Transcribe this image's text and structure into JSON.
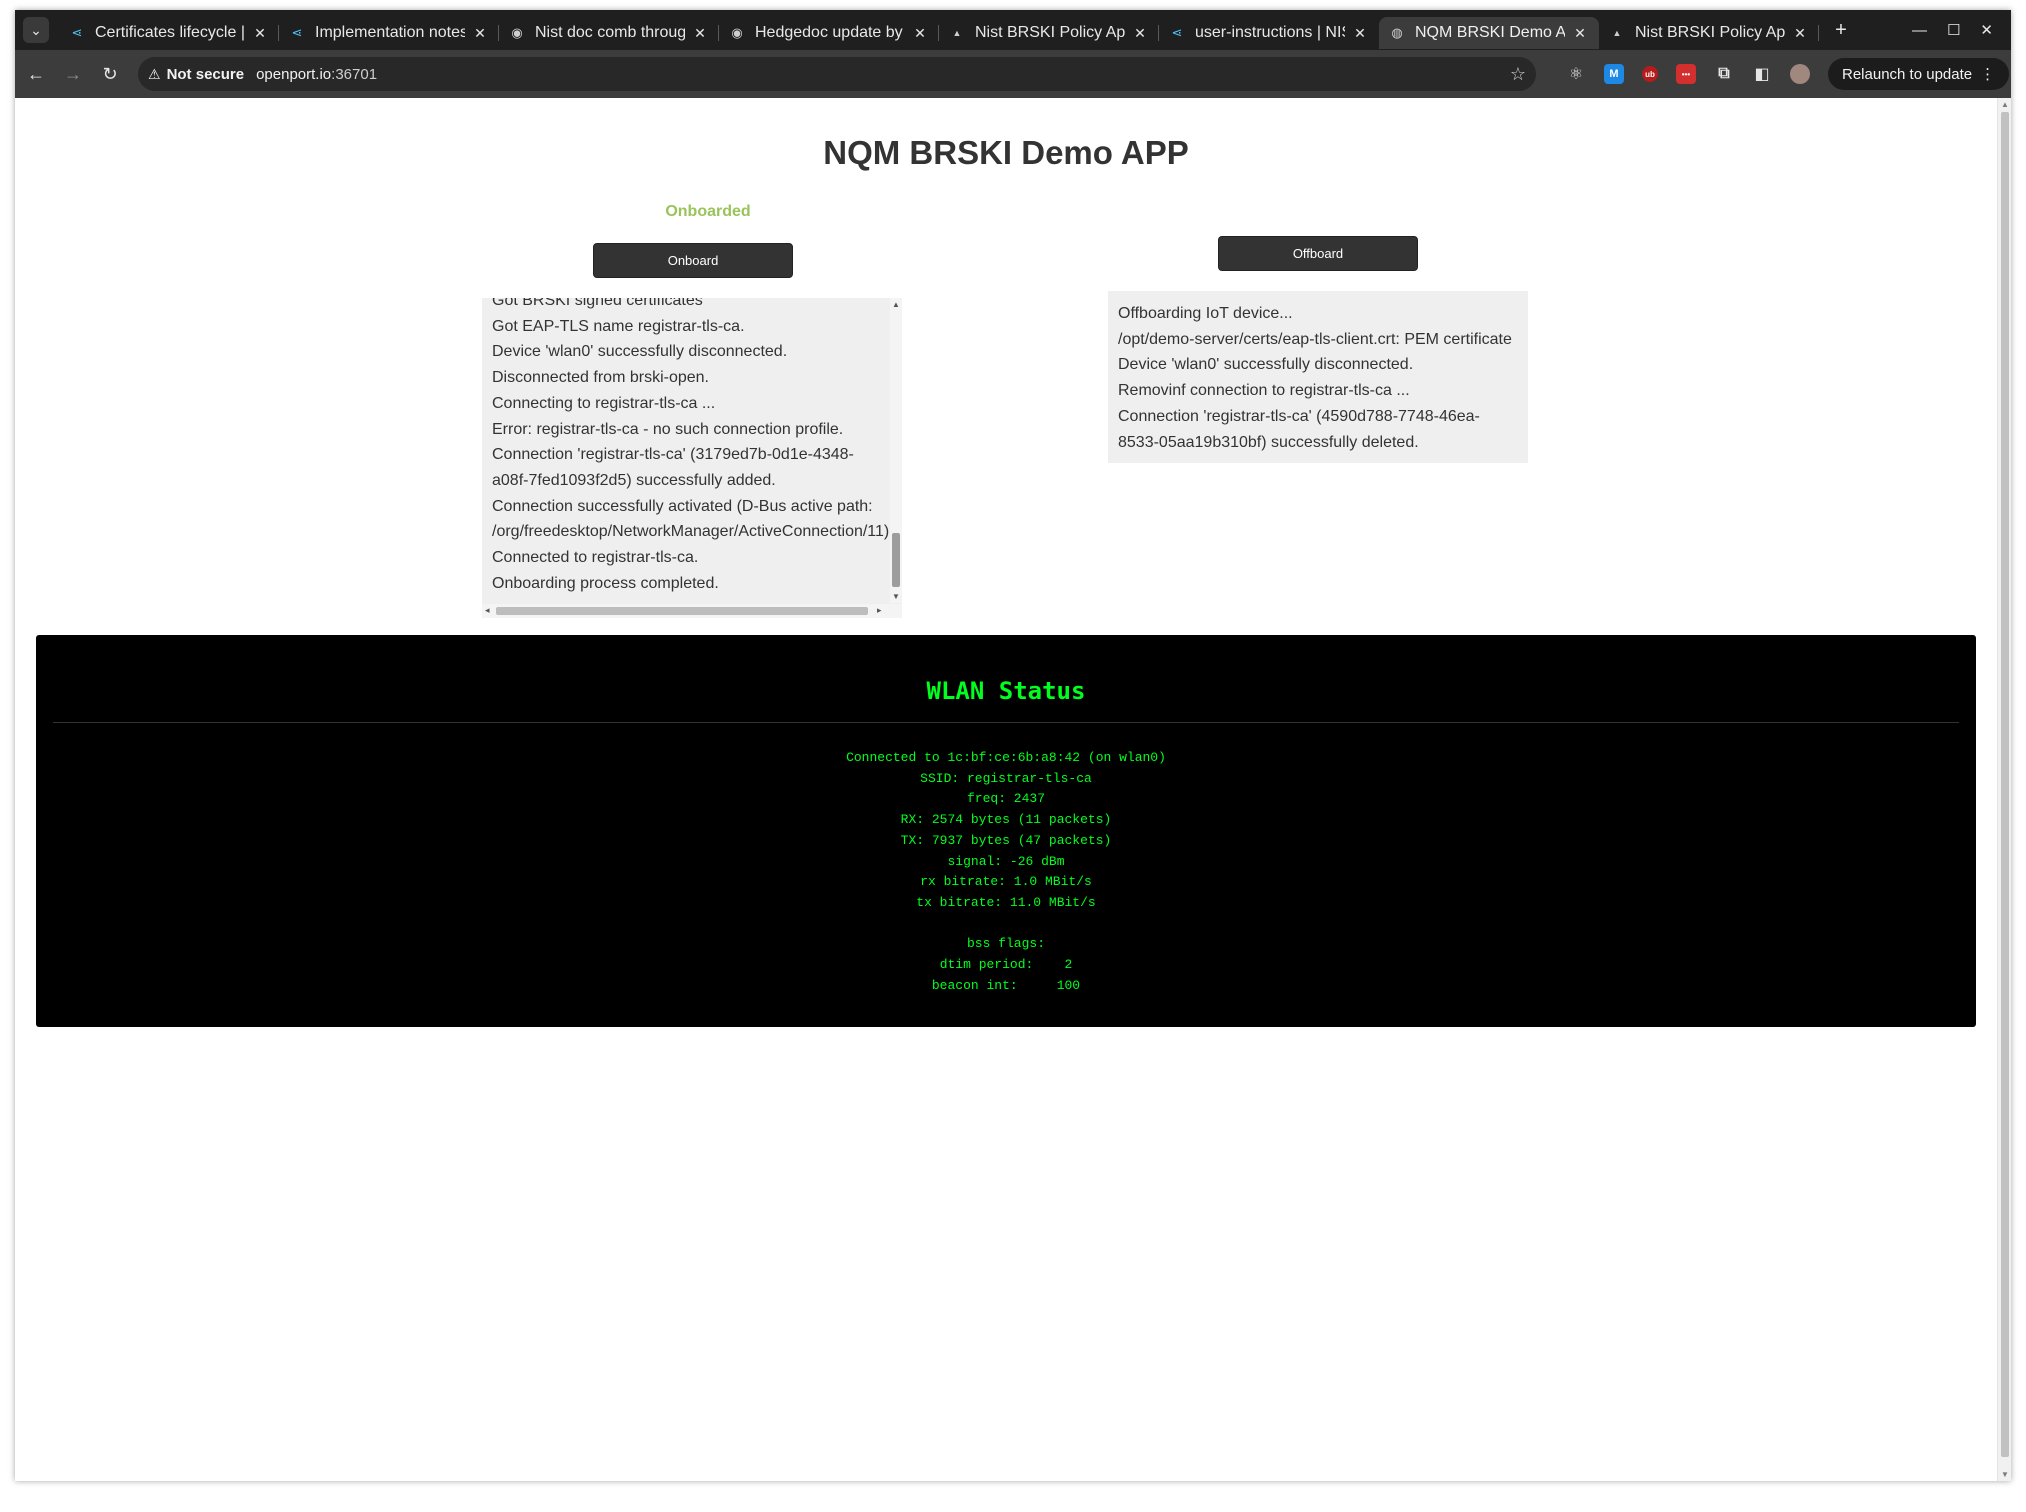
{
  "browser": {
    "tabs": [
      {
        "title": "Certificates lifecycle |",
        "icon": "share-icon"
      },
      {
        "title": "Implementation notes",
        "icon": "share-icon"
      },
      {
        "title": "Nist doc comb through",
        "icon": "github-icon"
      },
      {
        "title": "Hedgedoc update by a",
        "icon": "github-icon"
      },
      {
        "title": "Nist BRSKI Policy App",
        "icon": "triangle-icon"
      },
      {
        "title": "user-instructions | NIS",
        "icon": "share-icon"
      },
      {
        "title": "NQM BRSKI Demo APP",
        "icon": "globe-icon",
        "active": true
      },
      {
        "title": "Nist BRSKI Policy App",
        "icon": "triangle-icon"
      }
    ],
    "security_label": "Not secure",
    "url_host": "openport.io",
    "url_rest": ":36701",
    "relaunch_label": "Relaunch to update"
  },
  "app": {
    "title": "NQM BRSKI Demo APP",
    "status": "Onboarded",
    "onboard_label": "Onboard",
    "offboard_label": "Offboard",
    "onboard_log": [
      "Got BRSKI signed certificates",
      "Got EAP-TLS name registrar-tls-ca.",
      "Device 'wlan0' successfully disconnected.",
      "Disconnected from brski-open.",
      "Connecting to registrar-tls-ca ...",
      "Error: registrar-tls-ca - no such connection profile.",
      "Connection 'registrar-tls-ca' (3179ed7b-0d1e-4348-",
      "a08f-7fed1093f2d5) successfully added.",
      "Connection successfully activated (D-Bus active path:",
      "/org/freedesktop/NetworkManager/ActiveConnection/11)",
      "Connected to registrar-tls-ca.",
      "Onboarding process completed."
    ],
    "offboard_log": [
      "Offboarding IoT device...",
      "/opt/demo-server/certs/eap-tls-client.crt: PEM certificate",
      "Device 'wlan0' successfully disconnected.",
      "Removinf connection to registrar-tls-ca ...",
      "Connection 'registrar-tls-ca' (4590d788-7748-46ea-",
      "8533-05aa19b310bf) successfully deleted."
    ]
  },
  "wlan": {
    "title": "WLAN Status",
    "lines": [
      "Connected to 1c:bf:ce:6b:a8:42 (on wlan0)",
      "SSID: registrar-tls-ca",
      "freq: 2437",
      "RX: 2574 bytes (11 packets)",
      "TX: 7937 bytes (47 packets)",
      "signal: -26 dBm",
      "rx bitrate: 1.0 MBit/s",
      "tx bitrate: 11.0 MBit/s",
      "",
      "bss flags:",
      "dtim period:    2",
      "beacon int:     100"
    ]
  },
  "colors": {
    "status_green": "#9ac35b",
    "terminal_green": "#00ff1e",
    "button_bg": "#333333"
  }
}
